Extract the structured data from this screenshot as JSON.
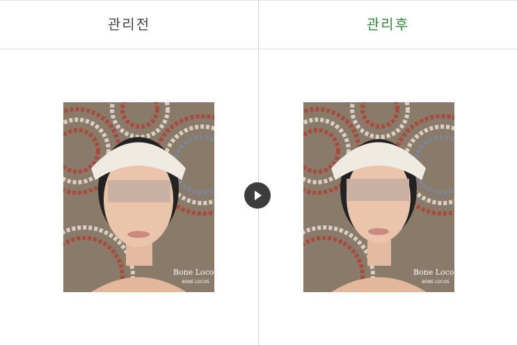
{
  "titles": {
    "before": "관리전",
    "after": "관리후"
  },
  "colors": {
    "title_before": "#444444",
    "title_after": "#2f8a3a",
    "divider": "#d6d6d6",
    "arrow_button": "#3c3c3c"
  },
  "photos": {
    "before": {
      "watermark_line1": "Bone Locos",
      "watermark_line2": "BONE LOCOS"
    },
    "after": {
      "watermark_line1": "Bone Locos",
      "watermark_line2": "BONE LOCOS"
    }
  },
  "icons": {
    "next": "play-arrow-icon"
  }
}
